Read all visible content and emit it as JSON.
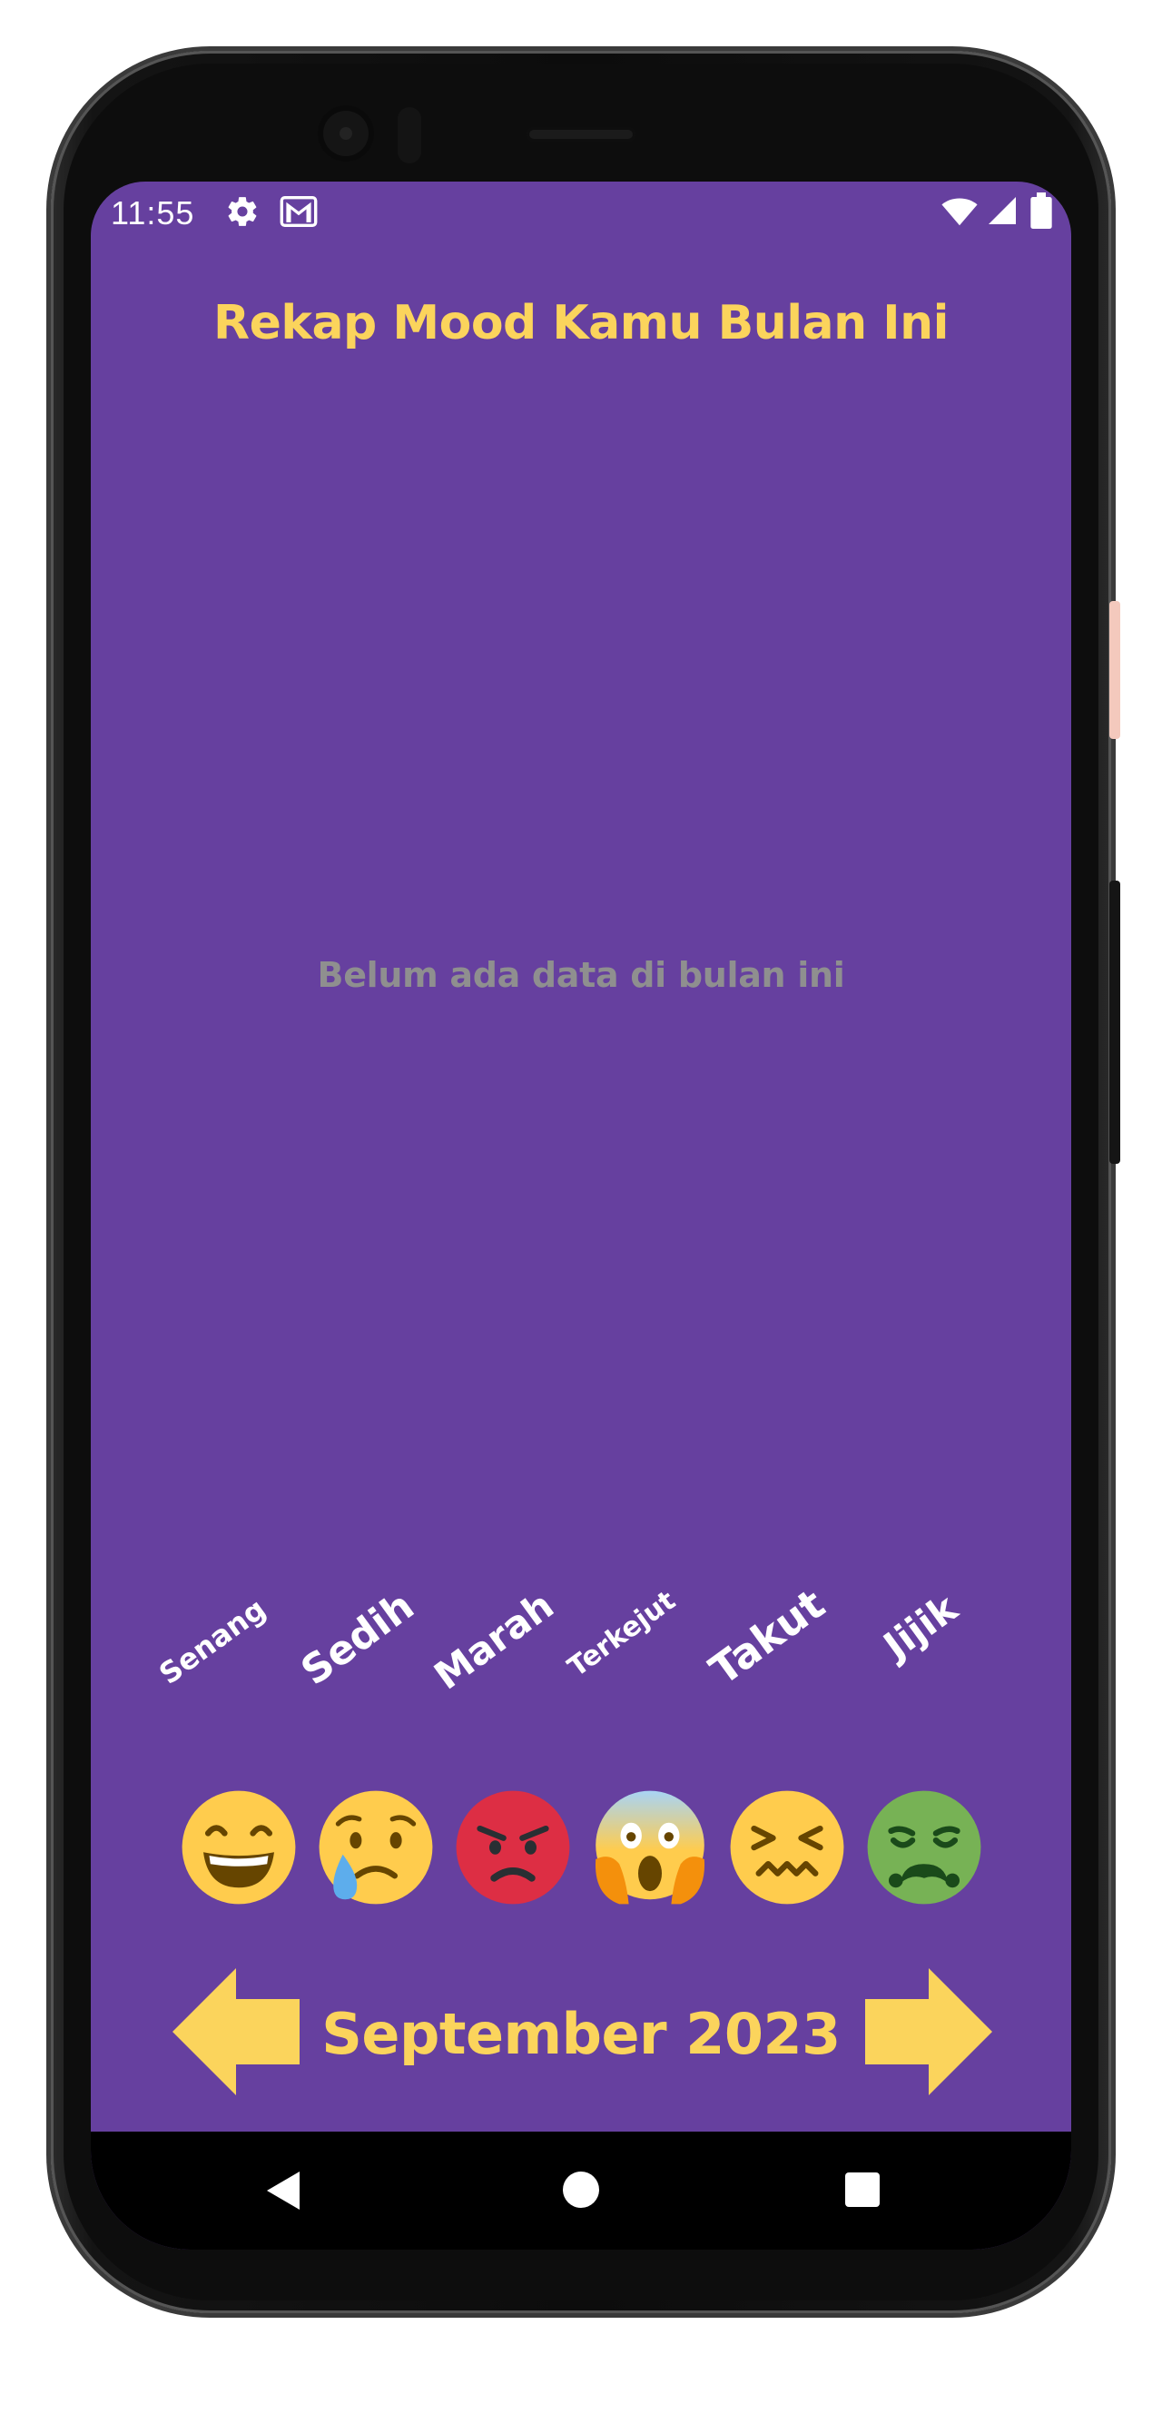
{
  "status_bar": {
    "time": "11:55",
    "icons": [
      "gear-icon",
      "gmail-icon",
      "wifi-icon",
      "signal-icon",
      "battery-icon"
    ]
  },
  "header": {
    "title": "Rekap Mood Kamu Bulan Ini"
  },
  "chart": {
    "empty_message": "Belum ada data di bulan ini"
  },
  "moods": [
    {
      "label": "Senang",
      "emoji": "grinning-face"
    },
    {
      "label": "Sedih",
      "emoji": "crying-face"
    },
    {
      "label": "Marah",
      "emoji": "angry-face"
    },
    {
      "label": "Terkejut",
      "emoji": "screaming-face"
    },
    {
      "label": "Takut",
      "emoji": "confounded-face"
    },
    {
      "label": "Jijik",
      "emoji": "nauseated-face"
    }
  ],
  "month_nav": {
    "current": "September 2023",
    "prev_icon": "arrow-left-icon",
    "next_icon": "arrow-right-icon"
  },
  "colors": {
    "background": "#66409f",
    "accent": "#fbd45c",
    "muted_text": "#8f8f8f"
  }
}
